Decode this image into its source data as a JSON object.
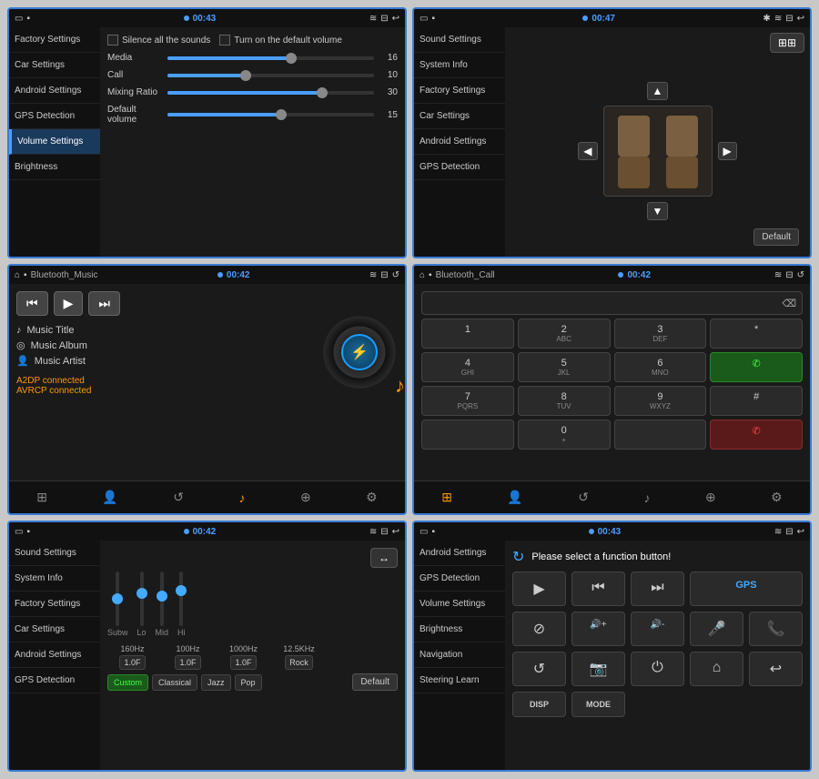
{
  "panels": [
    {
      "id": "volume-settings",
      "status_left": "▭ ▪",
      "status_time": "00:43",
      "status_icons": "≋ ⊟ ↩",
      "sidebar": [
        {
          "label": "Factory Settings",
          "active": false
        },
        {
          "label": "Car Settings",
          "active": false
        },
        {
          "label": "Android Settings",
          "active": false
        },
        {
          "label": "GPS Detection",
          "active": false
        },
        {
          "label": "Volume Settings",
          "active": true
        },
        {
          "label": "Brightness",
          "active": false
        }
      ],
      "checkboxes": [
        {
          "label": "Silence all the sounds"
        },
        {
          "label": "Turn on the default volume"
        }
      ],
      "sliders": [
        {
          "label": "Media",
          "value": 16,
          "percent": 60
        },
        {
          "label": "Call",
          "value": 10,
          "percent": 38
        },
        {
          "label": "Mixing Ratio",
          "value": 30,
          "percent": 75
        },
        {
          "label": "Default volume",
          "value": 15,
          "percent": 55
        }
      ]
    },
    {
      "id": "sound-settings",
      "status_left": "▭ ▪",
      "status_time": "00:47",
      "status_icons": "✱ ≋ ⊟ ↩",
      "sidebar": [
        {
          "label": "Sound Settings",
          "active": false
        },
        {
          "label": "System Info",
          "active": false
        },
        {
          "label": "Factory Settings",
          "active": false
        },
        {
          "label": "Car Settings",
          "active": false
        },
        {
          "label": "Android Settings",
          "active": false
        },
        {
          "label": "GPS Detection",
          "active": false
        }
      ],
      "default_btn": "Default"
    },
    {
      "id": "bluetooth-music",
      "status_left": "⌂",
      "app_name": "Bluetooth_Music",
      "status_time": "00:42",
      "status_icons": "≋ ⊟ ↺",
      "controls": [
        "⏮",
        "▶",
        "⏭"
      ],
      "music_info": [
        {
          "icon": "♪",
          "label": "Music Title"
        },
        {
          "icon": "◎",
          "label": "Music Album"
        },
        {
          "icon": "👤",
          "label": "Music Artist"
        }
      ],
      "connected": [
        "A2DP connected",
        "AVRCP connected"
      ],
      "toolbar_icons": [
        "⊞",
        "👤",
        "↺",
        "♪",
        "⊕",
        "⚙"
      ],
      "active_toolbar": 3
    },
    {
      "id": "bluetooth-call",
      "status_left": "⌂",
      "app_name": "Bluetooth_Call",
      "status_time": "00:42",
      "status_icons": "≋ ⊟ ↺",
      "dialpad": [
        {
          "label": "1",
          "sub": ""
        },
        {
          "label": "2",
          "sub": "ABC"
        },
        {
          "label": "3",
          "sub": "DEF"
        },
        {
          "label": "*",
          "sub": ""
        },
        {
          "label": "4",
          "sub": "GHI"
        },
        {
          "label": "5",
          "sub": "JKL"
        },
        {
          "label": "6",
          "sub": "MNO"
        },
        {
          "label": "✆",
          "sub": "",
          "type": "green"
        },
        {
          "label": "7",
          "sub": "PQRS"
        },
        {
          "label": "8",
          "sub": "TUV"
        },
        {
          "label": "9",
          "sub": "WXYZ"
        },
        {
          "label": "#",
          "sub": ""
        },
        {
          "label": "",
          "sub": ""
        },
        {
          "label": "0",
          "sub": "+"
        },
        {
          "label": "",
          "sub": ""
        },
        {
          "label": "✆",
          "sub": "",
          "type": "red"
        }
      ],
      "toolbar_icons": [
        "⊞",
        "👤",
        "↺",
        "♪",
        "⊕",
        "⚙"
      ],
      "active_toolbar": 0
    },
    {
      "id": "equalizer",
      "status_left": "▭ ▪",
      "status_time": "00:42",
      "status_icons": "≋ ⊟ ↩",
      "sidebar": [
        {
          "label": "Sound Settings",
          "active": false
        },
        {
          "label": "System Info",
          "active": false
        },
        {
          "label": "Factory Settings",
          "active": false
        },
        {
          "label": "Car Settings",
          "active": false
        },
        {
          "label": "Android Settings",
          "active": false
        },
        {
          "label": "GPS Detection",
          "active": false
        }
      ],
      "eq_bands": [
        {
          "label": "Subw",
          "pos": 40
        },
        {
          "label": "Lo",
          "pos": 30
        },
        {
          "label": "Mid",
          "pos": 35
        },
        {
          "label": "Hi",
          "pos": 25
        }
      ],
      "frequencies": [
        {
          "freq": "160Hz",
          "gain": "1.0F"
        },
        {
          "freq": "100Hz",
          "gain": "1.0F"
        },
        {
          "freq": "1000Hz",
          "gain": "1.0F"
        },
        {
          "freq": "12.5KHz",
          "gain": "Rock"
        }
      ],
      "presets": [
        "Custom",
        "Classical",
        "Jazz",
        "Pop"
      ],
      "active_preset": 0,
      "default_btn": "Default",
      "eq_icon": "↔"
    },
    {
      "id": "function-select",
      "status_left": "▭ ▪",
      "status_time": "00:43",
      "status_icons": "≋ ⊟ ↩",
      "sidebar": [
        {
          "label": "Android Settings",
          "active": false
        },
        {
          "label": "GPS Detection",
          "active": false
        },
        {
          "label": "Volume Settings",
          "active": false
        },
        {
          "label": "Brightness",
          "active": false
        },
        {
          "label": "Navigation",
          "active": false
        },
        {
          "label": "Steering Learn",
          "active": false
        }
      ],
      "header": "Please select a function button!",
      "functions": [
        {
          "icon": "▶",
          "label": ""
        },
        {
          "icon": "⏮",
          "label": ""
        },
        {
          "icon": "⏭",
          "label": ""
        },
        {
          "icon": "GPS",
          "label": "GPS",
          "text": true
        },
        {
          "icon": "⊘",
          "label": ""
        },
        {
          "icon": "🔊+",
          "label": ""
        },
        {
          "icon": "🔊-",
          "label": ""
        },
        {
          "icon": "🎤",
          "label": ""
        },
        {
          "icon": "📞",
          "label": ""
        },
        {
          "icon": "↺",
          "label": ""
        },
        {
          "icon": "📷",
          "label": ""
        },
        {
          "icon": "⏻",
          "label": ""
        },
        {
          "icon": "⌂",
          "label": ""
        },
        {
          "icon": "↩",
          "label": ""
        },
        {
          "icon": "DISP",
          "label": "DISP",
          "text": true
        },
        {
          "icon": "MODE",
          "label": "MODE",
          "text": true
        }
      ]
    }
  ]
}
